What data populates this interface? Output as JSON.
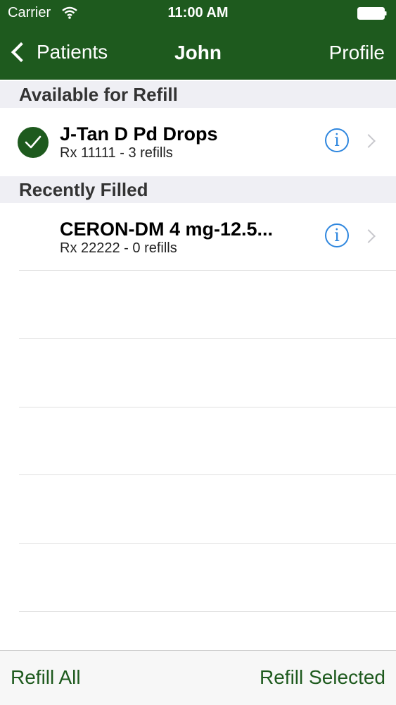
{
  "status_bar": {
    "carrier": "Carrier",
    "time": "11:00 AM"
  },
  "nav": {
    "back_label": "Patients",
    "title": "John",
    "right_label": "Profile"
  },
  "sections": [
    {
      "header": "Available for Refill",
      "items": [
        {
          "name": "J-Tan D Pd Drops",
          "detail": "Rx 11111 - 3 refills",
          "selected": true
        }
      ]
    },
    {
      "header": "Recently Filled",
      "items": [
        {
          "name": "CERON-DM 4 mg-12.5...",
          "detail": "Rx 22222 - 0 refills",
          "selected": false
        }
      ]
    }
  ],
  "toolbar": {
    "refill_all": "Refill All",
    "refill_selected": "Refill Selected"
  },
  "colors": {
    "brand_green": "#1e5a1e",
    "info_blue": "#2e86de",
    "section_bg": "#efeff4"
  }
}
